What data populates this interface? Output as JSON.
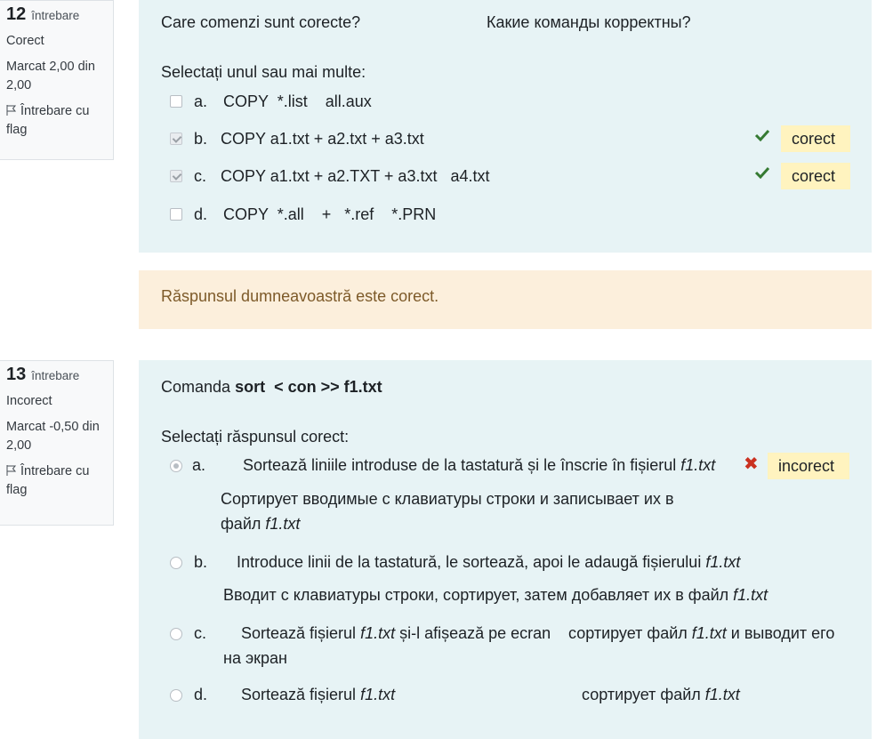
{
  "q12": {
    "number": "12",
    "word": "întrebare",
    "state": "Corect",
    "grade": "Marcat 2,00 din 2,00",
    "flag": "Întrebare cu flag",
    "qtext_ro": "Care comenzi sunt corecte?",
    "qtext_ru": "Какие команды корректны?",
    "prompt": "Selectați unul sau mai multe:",
    "options": [
      {
        "letter": "a.",
        "text": "COPY  *.list    all.aux",
        "checked": false
      },
      {
        "letter": "b.",
        "text": "COPY a1.txt + a2.txt + a3.txt",
        "checked": true,
        "badge": "corect"
      },
      {
        "letter": "c.",
        "text": "COPY a1.txt + a2.TXT + a3.txt   a4.txt",
        "checked": true,
        "badge": "corect"
      },
      {
        "letter": "d.",
        "text": "COPY  *.all    +   *.ref    *.PRN",
        "checked": false
      }
    ],
    "feedback": "Răspunsul dumneavoastră este corect."
  },
  "q13": {
    "number": "13",
    "word": "întrebare",
    "state": "Incorect",
    "grade": "Marcat -0,50 din 2,00",
    "flag": "Întrebare cu flag",
    "qtext_prefix": "Comanda ",
    "qtext_cmd": "sort  < con >> f1.txt",
    "prompt": "Selectați răspunsul corect:",
    "options": [
      {
        "letter": "a.",
        "ro": "Sortează liniile introduse de la tastatură și le înscrie în fișierul ",
        "ro_file": "f1.txt",
        "ru_line1": "Сортирует вводимые с клавиатуры строки и записывает их в",
        "ru_line2": "файл ",
        "ru_file": "f1.txt",
        "checked": true,
        "badge": "incorect"
      },
      {
        "letter": "b.",
        "ro": "Introduce linii de la tastatură, le sortează, apoi le adaugă fișierului ",
        "ro_file": "f1.txt",
        "ru": "Вводит с клавиатуры строки, сортирует, затем добавляет их в файл ",
        "ru_file": "f1.txt",
        "checked": false
      },
      {
        "letter": "c.",
        "ro_a": "Sortează fișierul ",
        "ro_file": "f1.txt",
        "ro_b": " și-l afișează pe ecran",
        "ru_a": "сортирует файл ",
        "ru_file": "f1.txt",
        "ru_b": " и выводит его",
        "ru_line2": "на экран",
        "checked": false
      },
      {
        "letter": "d.",
        "ro": "Sortează fișierul ",
        "ro_file": "f1.txt",
        "ru": "сортирует файл ",
        "ru_file": "f1.txt",
        "checked": false
      }
    ]
  },
  "colors": {
    "correct": "#357a32",
    "incorrect": "#ca3120",
    "badge_bg": "#fff3bf",
    "panel_bg": "#e7f3f5",
    "feedback_bg": "#fcefdc"
  }
}
